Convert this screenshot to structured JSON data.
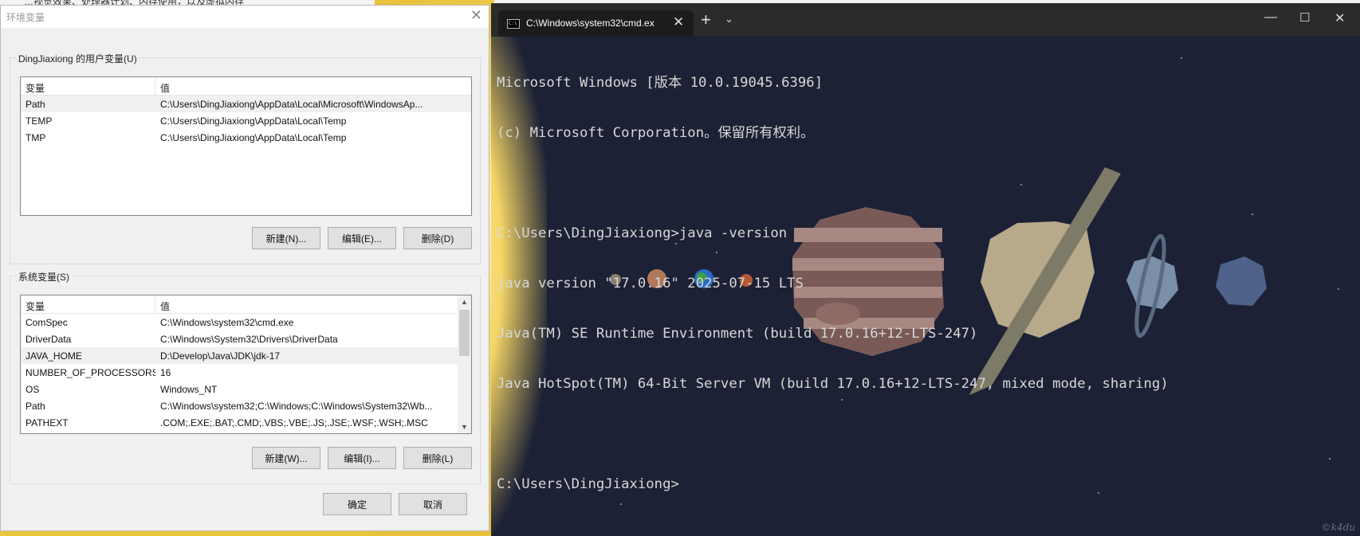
{
  "background": {
    "top_text": "…视觉效果、处理器计划、内存使用，以及虚拟内存"
  },
  "dialog": {
    "title": "环境变量",
    "user_group_label": "DingJiaxiong 的用户变量(U)",
    "system_group_label": "系统变量(S)",
    "columns": {
      "name": "变量",
      "value": "值"
    },
    "user_vars": [
      {
        "name": "Path",
        "value": "C:\\Users\\DingJiaxiong\\AppData\\Local\\Microsoft\\WindowsAp..."
      },
      {
        "name": "TEMP",
        "value": "C:\\Users\\DingJiaxiong\\AppData\\Local\\Temp"
      },
      {
        "name": "TMP",
        "value": "C:\\Users\\DingJiaxiong\\AppData\\Local\\Temp"
      }
    ],
    "system_vars": [
      {
        "name": "ComSpec",
        "value": "C:\\Windows\\system32\\cmd.exe"
      },
      {
        "name": "DriverData",
        "value": "C:\\Windows\\System32\\Drivers\\DriverData"
      },
      {
        "name": "JAVA_HOME",
        "value": "D:\\Develop\\Java\\JDK\\jdk-17"
      },
      {
        "name": "NUMBER_OF_PROCESSORS",
        "value": "16"
      },
      {
        "name": "OS",
        "value": "Windows_NT"
      },
      {
        "name": "Path",
        "value": "C:\\Windows\\system32;C:\\Windows;C:\\Windows\\System32\\Wb..."
      },
      {
        "name": "PATHEXT",
        "value": ".COM;.EXE;.BAT;.CMD;.VBS;.VBE;.JS;.JSE;.WSF;.WSH;.MSC"
      }
    ],
    "user_buttons": {
      "new": "新建(N)...",
      "edit": "编辑(E)...",
      "delete": "删除(D)"
    },
    "system_buttons": {
      "new": "新建(W)...",
      "edit": "编辑(I)...",
      "delete": "删除(L)"
    },
    "ok": "确定",
    "cancel": "取消"
  },
  "terminal": {
    "tab_title": "C:\\Windows\\system32\\cmd.ex",
    "lines": [
      "Microsoft Windows [版本 10.0.19045.6396]",
      "(c) Microsoft Corporation。保留所有权利。",
      "",
      "C:\\Users\\DingJiaxiong>java -version",
      "java version \"17.0.16\" 2025-07-15 LTS",
      "Java(TM) SE Runtime Environment (build 17.0.16+12-LTS-247)",
      "Java HotSpot(TM) 64-Bit Server VM (build 17.0.16+12-LTS-247, mixed mode, sharing)",
      "",
      "C:\\Users\\DingJiaxiong>"
    ],
    "wallpaper_credit": "©k4du"
  },
  "colors": {
    "terminal_bg": "#1c2135",
    "titlebar": "#2b2b2b",
    "dialog_bg": "#f0f0f0"
  }
}
